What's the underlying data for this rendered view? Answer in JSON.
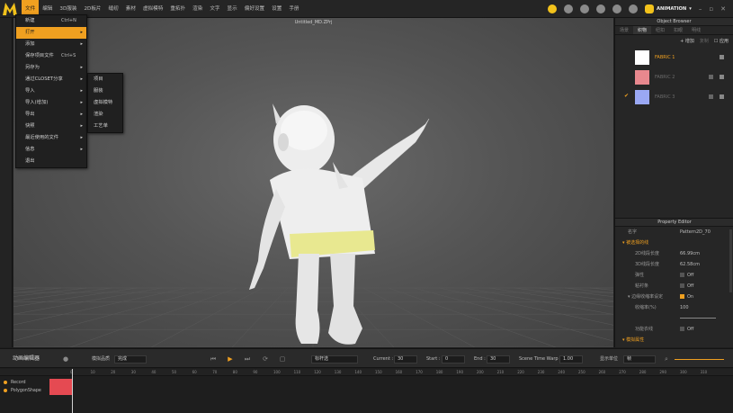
{
  "app": {
    "document_title": "Untitled_MD.ZPrj"
  },
  "menubar": {
    "items": [
      "文件",
      "编辑",
      "3D服装",
      "2D板片",
      "缝纫",
      "素材",
      "虚拟模特",
      "重拓扑",
      "渲染",
      "文字",
      "显示",
      "偏好设置",
      "设置",
      "手册"
    ],
    "mode_label": "ANIMATION"
  },
  "file_menu": {
    "items": [
      {
        "label": "新建",
        "shortcut": "Ctrl+N",
        "has_sub": false
      },
      {
        "label": "打开",
        "shortcut": "",
        "has_sub": true
      },
      {
        "label": "添加",
        "shortcut": "",
        "has_sub": true
      },
      {
        "label": "保存项目文件",
        "shortcut": "Ctrl+S",
        "has_sub": false
      },
      {
        "label": "另存为",
        "shortcut": "",
        "has_sub": true
      },
      {
        "label": "通过CLOSET分享",
        "shortcut": "",
        "has_sub": true
      },
      {
        "label": "导入",
        "shortcut": "",
        "has_sub": true
      },
      {
        "label": "导入(增加)",
        "shortcut": "",
        "has_sub": true
      },
      {
        "label": "导出",
        "shortcut": "",
        "has_sub": true
      },
      {
        "label": "快照",
        "shortcut": "",
        "has_sub": true
      },
      {
        "label": "最近使用的文件",
        "shortcut": "",
        "has_sub": true
      },
      {
        "label": "信息",
        "shortcut": "",
        "has_sub": true
      },
      {
        "label": "退出",
        "shortcut": "",
        "has_sub": false
      }
    ]
  },
  "sub_menu": {
    "items": [
      "项目",
      "服装",
      "虚拟模特",
      "渲染",
      "工艺单"
    ]
  },
  "object_browser": {
    "title": "Object Browser",
    "tabs": [
      "场景",
      "织物",
      "纽扣",
      "扣眼",
      "明线"
    ],
    "active_tab": 1,
    "add_label": "增加",
    "copy_label": "复制",
    "apply_label": "应用",
    "fabrics": [
      {
        "name": "FABRIC 1",
        "color": "#ffffff",
        "selected": false
      },
      {
        "name": "FABRIC 2",
        "color": "#e8888e",
        "selected": false
      },
      {
        "name": "FABRIC 3",
        "color": "#9aa8f4",
        "selected": true
      }
    ]
  },
  "property_editor": {
    "title": "Property Editor",
    "name_label": "名字",
    "name_value": "Pattern2D_70",
    "section_selected": "被选择的线",
    "rows": [
      {
        "label": "2D线段长度",
        "value": "66.99cm"
      },
      {
        "label": "3D线段长度",
        "value": "62.58cm"
      },
      {
        "label": "弹性",
        "value": "Off"
      },
      {
        "label": "粘衬条",
        "value": "Off"
      }
    ],
    "edge_shrink_label": "边缘收缩率设定",
    "edge_shrink_value": "On",
    "shrink_ratio_label": "收缩率(%)",
    "shrink_ratio_value": "100",
    "fold_label": "功能衣线",
    "fold_value": "Off",
    "section_pattern": "模拟属性"
  },
  "animation": {
    "title": "动画编辑器",
    "model_label": "模拟品质",
    "model_value": "完成",
    "motion_value": "标杆选",
    "current_label": "Current :",
    "current_value": "30",
    "start_label": "Start :",
    "start_value": "0",
    "end_label": "End :",
    "end_value": "30",
    "warp_label": "Scene Time Warp :",
    "warp_value": "1.00",
    "unit_label": "显示单位",
    "unit_value": "帧",
    "ruler_ticks": [
      "0",
      "10",
      "20",
      "30",
      "40",
      "50",
      "60",
      "70",
      "80",
      "90",
      "100",
      "110",
      "120",
      "130",
      "140",
      "150",
      "160",
      "170",
      "180",
      "190",
      "200",
      "210",
      "220",
      "230",
      "240",
      "250",
      "260",
      "270",
      "280",
      "290",
      "300",
      "310"
    ],
    "tracks": [
      "Record",
      "PolygonShape"
    ]
  },
  "colors": {
    "accent": "#f0a020",
    "track": "#e54a52",
    "yellow_trim": "#e8e890"
  }
}
